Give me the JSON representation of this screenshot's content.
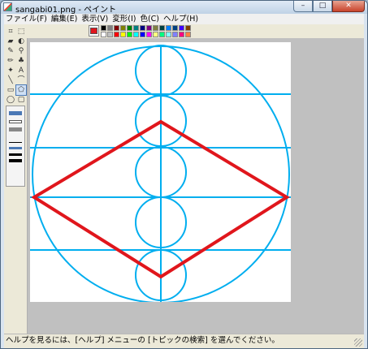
{
  "window": {
    "title": "sangabi01.png - ペイント"
  },
  "caption_buttons": {
    "min": "–",
    "max": "□",
    "close": "✕"
  },
  "menu": [
    "ファイル(F)",
    "編集(E)",
    "表示(V)",
    "変形(I)",
    "色(C)",
    "ヘルプ(H)"
  ],
  "tools": [
    {
      "name": "free-select-icon",
      "glyph": "⌗"
    },
    {
      "name": "rect-select-icon",
      "glyph": "⬚"
    },
    {
      "name": "eraser-icon",
      "glyph": "▰"
    },
    {
      "name": "fill-icon",
      "glyph": "◐"
    },
    {
      "name": "color-picker-icon",
      "glyph": "✎"
    },
    {
      "name": "magnifier-icon",
      "glyph": "⚲"
    },
    {
      "name": "pencil-icon",
      "glyph": "✏"
    },
    {
      "name": "brush-icon",
      "glyph": "♣"
    },
    {
      "name": "airbrush-icon",
      "glyph": "✦"
    },
    {
      "name": "text-icon",
      "glyph": "A"
    },
    {
      "name": "line-icon",
      "glyph": "╲"
    },
    {
      "name": "curve-icon",
      "glyph": "⌒"
    },
    {
      "name": "rectangle-icon",
      "glyph": "▭"
    },
    {
      "name": "polygon-icon",
      "glyph": "⬠"
    },
    {
      "name": "ellipse-icon",
      "glyph": "◯"
    },
    {
      "name": "rounded-rect-icon",
      "glyph": "▢"
    }
  ],
  "selected_tool": "polygon-icon",
  "palette": {
    "foreground": "#e0161c",
    "row1": [
      "#000000",
      "#808080",
      "#800000",
      "#808000",
      "#008000",
      "#008080",
      "#000080",
      "#800080",
      "#808040",
      "#004040",
      "#0080ff",
      "#004080",
      "#4000ff",
      "#804000"
    ],
    "row2": [
      "#ffffff",
      "#c0c0c0",
      "#ff0000",
      "#ffff00",
      "#00ff00",
      "#00ffff",
      "#0000ff",
      "#ff00ff",
      "#ffff80",
      "#00ff80",
      "#80ffff",
      "#8080ff",
      "#ff0080",
      "#ff8040"
    ]
  },
  "drawing": {
    "circle_color": "#00aeef",
    "diamond_color": "#e0161c"
  },
  "status": {
    "text": "ヘルプを見るには、[ヘルプ] メニューの [トピックの検索] を選んでください。"
  }
}
